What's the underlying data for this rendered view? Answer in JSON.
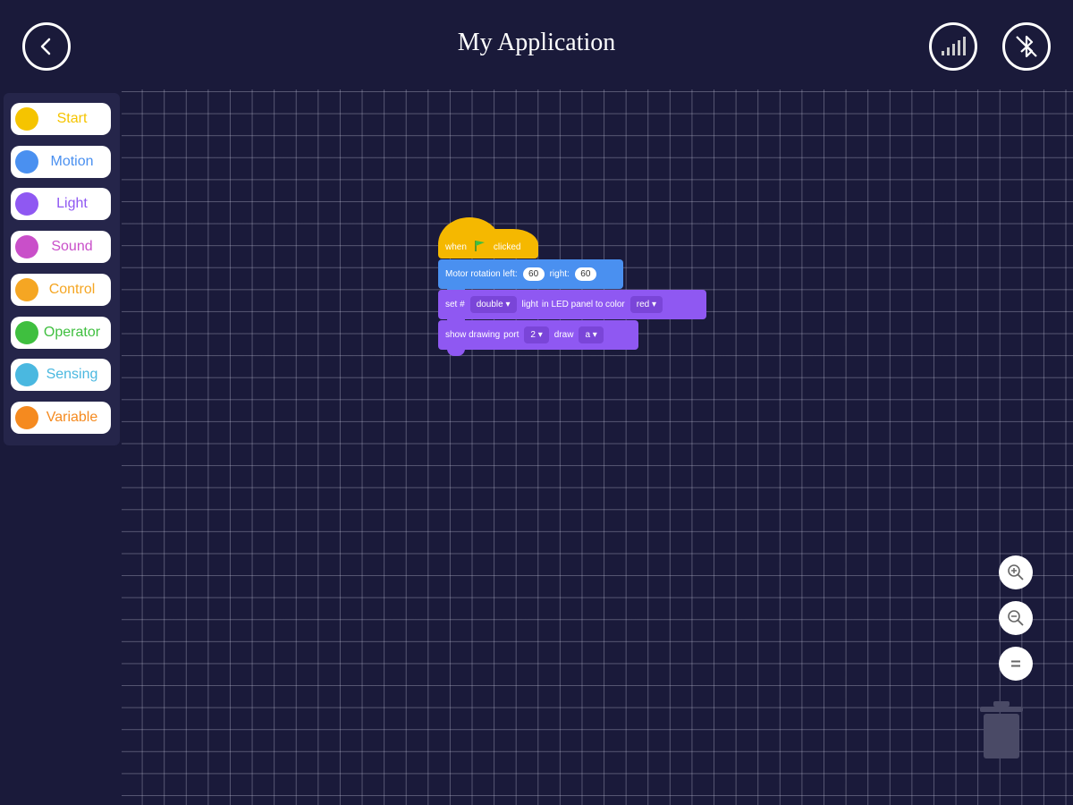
{
  "header": {
    "title": "My Application",
    "back_icon": "chevron-left-icon",
    "signal_icon": "signal-bars-icon",
    "bluetooth_icon": "bluetooth-disabled-icon"
  },
  "sidebar": {
    "categories": [
      {
        "label": "Start",
        "color": "#f5c400"
      },
      {
        "label": "Motion",
        "color": "#4a90f0"
      },
      {
        "label": "Light",
        "color": "#8f58f2"
      },
      {
        "label": "Sound",
        "color": "#c94fc9"
      },
      {
        "label": "Control",
        "color": "#f5a623"
      },
      {
        "label": "Operator",
        "color": "#3fbf3f"
      },
      {
        "label": "Sensing",
        "color": "#4ab8e0"
      },
      {
        "label": "Variable",
        "color": "#f58a1f"
      }
    ]
  },
  "blocks": {
    "hat": {
      "when": "when",
      "flag_icon": "green-flag-icon",
      "clicked": "clicked"
    },
    "motion": {
      "text": "Motor rotation left:",
      "left_value": "60",
      "right_label": "right:",
      "right_value": "60"
    },
    "light": {
      "set": "set #",
      "count": "double",
      "light": "light",
      "in_panel": "in LED panel to color",
      "color": "red"
    },
    "draw": {
      "text": "show drawing",
      "port_label": "port",
      "port": "2",
      "draw_label": "draw",
      "draw_value": "a"
    }
  },
  "zoom": {
    "in_icon": "zoom-in-icon",
    "out_icon": "zoom-out-icon",
    "reset_icon": "reset-zoom-icon"
  },
  "trash_icon": "trash-icon"
}
